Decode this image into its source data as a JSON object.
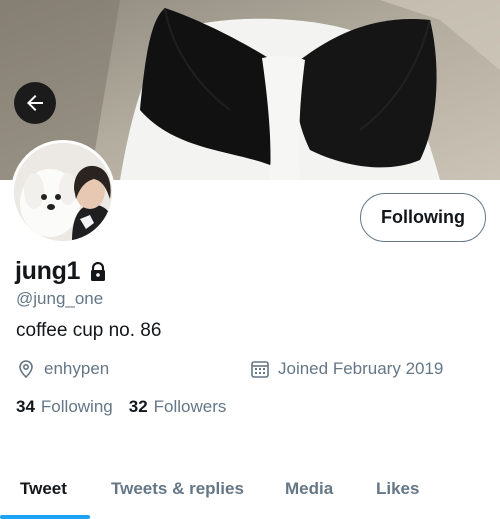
{
  "profile": {
    "display_name": "jung1",
    "handle": "@jung_one",
    "bio": "coffee cup no. 86",
    "location": "enhypen",
    "joined": "Joined February 2019",
    "locked": true
  },
  "actions": {
    "follow_label": "Following"
  },
  "stats": {
    "following_count": "34",
    "following_label": "Following",
    "followers_count": "32",
    "followers_label": "Followers"
  },
  "tabs": [
    {
      "label": "Tweet",
      "active": true
    },
    {
      "label": "Tweets & replies",
      "active": false
    },
    {
      "label": "Media",
      "active": false
    },
    {
      "label": "Likes",
      "active": false
    }
  ],
  "icons": {
    "back": "arrow-left-icon",
    "lock": "lock-icon",
    "location": "location-pin-icon",
    "joined": "calendar-icon"
  },
  "colors": {
    "accent": "#1da1f2",
    "secondary_text": "#657786",
    "primary_text": "#14171a"
  }
}
